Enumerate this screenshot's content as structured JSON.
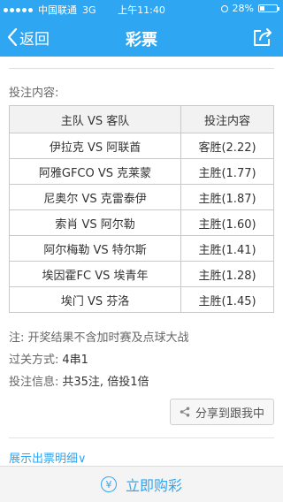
{
  "status_bar": {
    "carrier": "中国联通",
    "network": "3G",
    "time": "上午11:40",
    "battery": "28%",
    "battery_level": 0.28
  },
  "nav": {
    "back_label": "返回",
    "title": "彩票",
    "share_icon": "share-icon"
  },
  "bet": {
    "section_label": "投注内容:",
    "columns": [
      "主队 VS 客队",
      "投注内容"
    ],
    "rows": [
      {
        "match": "伊拉克 VS 阿联酋",
        "pick": "客胜(2.22)"
      },
      {
        "match": "阿雅GFCO VS 克莱蒙",
        "pick": "主胜(1.77)"
      },
      {
        "match": "尼奥尔 VS 克雷泰伊",
        "pick": "主胜(1.87)"
      },
      {
        "match": "索肖 VS 阿尔勒",
        "pick": "主胜(1.60)"
      },
      {
        "match": "阿尔梅勒 VS 特尔斯",
        "pick": "主胜(1.41)"
      },
      {
        "match": "埃因霍FC VS 埃青年",
        "pick": "主胜(1.28)"
      },
      {
        "match": "埃门 VS 芬洛",
        "pick": "主胜(1.45)"
      }
    ],
    "note": "注: 开奖结果不含加时赛及点球大战",
    "pass_label": "过关方式:",
    "pass_value": "4串1",
    "info_label": "投注信息:",
    "info_value": "共35注, 倍投1倍"
  },
  "share_button_label": "分享到跟我中",
  "detail_link": "展示出票明细∨",
  "buy_button_label": "立即购彩",
  "colors": {
    "accent": "#2ea6f2"
  }
}
